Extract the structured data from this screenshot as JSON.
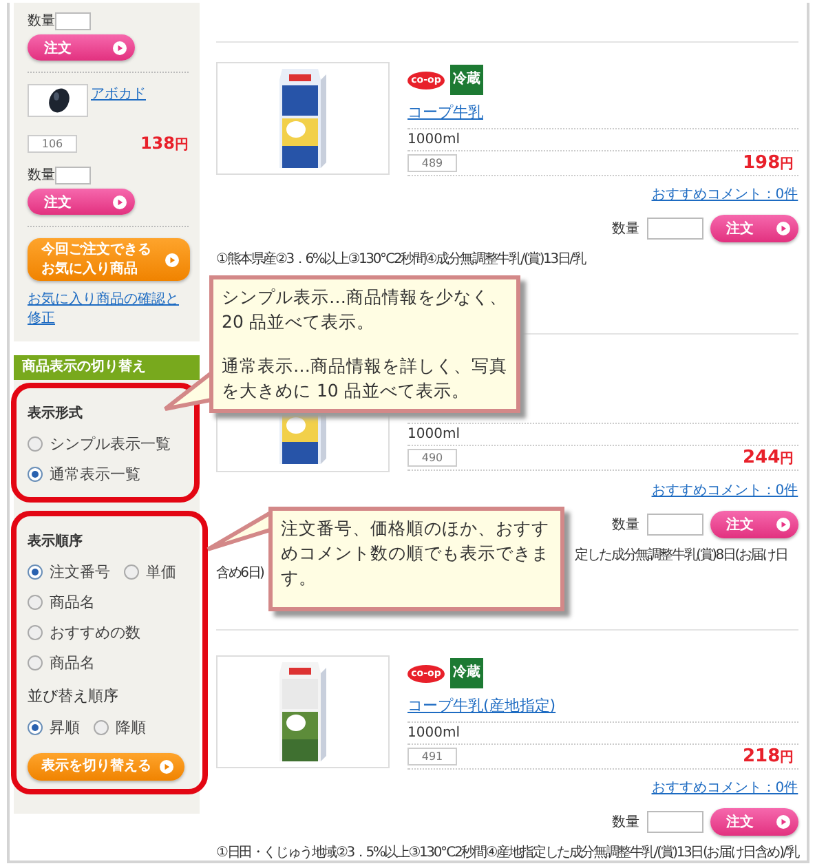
{
  "sidebar": {
    "top_order": {
      "quantity_label": "数量",
      "button": "注文"
    },
    "favorite_item": {
      "name": "アボカド",
      "code": "106",
      "price": "138",
      "currency": "円",
      "quantity_label": "数量",
      "button": "注文"
    },
    "favorites_button": [
      "今回ご注文できる",
      "お気に入り商品"
    ],
    "favorites_link": "お気に入り商品の確認と修正",
    "display_switch": {
      "title": "商品表示の切り替え",
      "format": {
        "label": "表示形式",
        "rows": [
          {
            "options": [
              {
                "label": "シンプル表示一覧",
                "selected": false
              }
            ]
          },
          {
            "options": [
              {
                "label": "通常表示一覧",
                "selected": true
              }
            ]
          }
        ]
      },
      "order": {
        "label": "表示順序",
        "rows": [
          {
            "options": [
              {
                "label": "注文番号",
                "selected": true
              },
              {
                "label": "単価",
                "selected": false
              }
            ]
          },
          {
            "options": [
              {
                "label": "商品名",
                "selected": false
              }
            ]
          },
          {
            "options": [
              {
                "label": "おすすめの数",
                "selected": false
              }
            ]
          },
          {
            "options": [
              {
                "label": "商品名",
                "selected": false
              }
            ]
          }
        ]
      },
      "direction": {
        "label": "並び替え順序",
        "rows": [
          {
            "options": [
              {
                "label": "昇順",
                "selected": true
              },
              {
                "label": "降順",
                "selected": false
              }
            ]
          }
        ]
      },
      "button": "表示を切り替える"
    }
  },
  "products": [
    {
      "brand": "co-op",
      "badge": "冷蔵",
      "name": "コープ牛乳",
      "volume": "1000ml",
      "code": "489",
      "price": "198",
      "currency": "円",
      "comments_link": "おすすめコメント：0件",
      "quantity_label": "数量",
      "order_button": "注文",
      "description": "①熊本県産②3．6%以上③130℃2秒間④成分無調整牛乳/(賞)13日/乳"
    },
    {
      "volume": "1000ml",
      "code": "490",
      "price": "244",
      "currency": "円",
      "comments_link": "おすすめコメント：0件",
      "quantity_label": "数量",
      "order_button": "注文",
      "description_tail": "定した成分無調整牛乳(賞)8日(お届け日",
      "description_continued": "含め6日)"
    },
    {
      "brand": "co-op",
      "badge": "冷蔵",
      "name": "コープ牛乳(産地指定)",
      "volume": "1000ml",
      "code": "491",
      "price": "218",
      "currency": "円",
      "comments_link": "おすすめコメント：0件",
      "quantity_label": "数量",
      "order_button": "注文",
      "description": "①日田・くじゅう地域②3．5%以上③130℃2秒間④産地指定した成分無調整牛乳/(賞)13日(お届け日含め)/乳"
    }
  ],
  "callouts": [
    {
      "paragraphs": [
        "シンプル表示…商品情報を少なく、20 品並べて表示。",
        "通常表示…商品情報を詳しく、写真を大きめに 10 品並べて表示。"
      ]
    },
    {
      "paragraphs": [
        "注文番号、価格順のほか、おすすめコメント数の順でも表示できます。"
      ]
    }
  ]
}
